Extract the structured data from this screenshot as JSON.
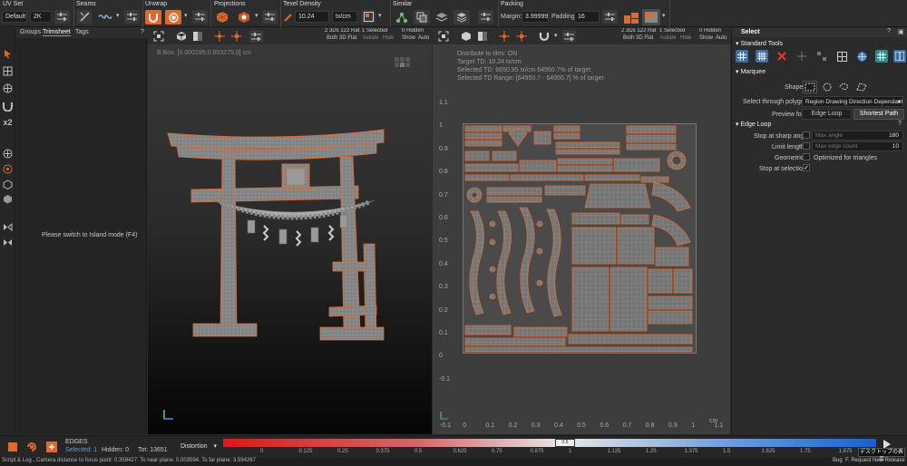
{
  "toolbar": {
    "sections": [
      "UV Set",
      "Seams",
      "Unwrap",
      "Projections",
      "Texel Density",
      "Similar",
      "Packing"
    ],
    "uvset_value": "Default",
    "uvset_num": "2K",
    "texel_value": "10.24",
    "texel_unit": "tx/cm",
    "margin_label": "Margin:",
    "margin_value": "3.99999",
    "padding_label": "Padding:",
    "padding_value": "16"
  },
  "left_panel": {
    "tabs": [
      "Groups",
      "Trimsheet",
      "Tags"
    ],
    "message": "Please switch to Island mode (F4)"
  },
  "viewport3d": {
    "bbox": "B Box: [0.000185,0.003275,0] cm",
    "stats_line1": "2 3Ds 122 Rat",
    "stats_line2": "Both 3D Flat",
    "selected_label": "1 Selected",
    "isolate_label": "Isolate",
    "hide_label": "Hide",
    "hidden_label": "0 Hidden",
    "show_label": "Show",
    "auto_label": "Auto"
  },
  "uv_view": {
    "info": [
      "Distribute to tiles: ON",
      "Target TD: 10.24 tx/cm",
      "Selected TD: 6650.95 tx/cm 64950.7% of target",
      "Selected TD Range: [64950.7 - 64950.7] % of target"
    ],
    "stats_line1": "2 3Ds 122 Rat",
    "stats_line2": "Both 3D Flat",
    "selected_label": "1 Selected",
    "isolate_label": "Isolate",
    "hide_label": "Hide",
    "hidden_label": "0 Hidden",
    "show_label": "Show",
    "auto_label": "Auto",
    "y_ticks": [
      "1.1",
      "1",
      "0.9",
      "0.8",
      "0.7",
      "0.6",
      "0.5",
      "0.4",
      "0.3",
      "0.2",
      "0.1",
      "0",
      "-0.1"
    ],
    "x_ticks": [
      "-0.1",
      "0",
      "0.1",
      "0.2",
      "0.3",
      "0.4",
      "0.5",
      "0.6",
      "0.7",
      "0.8",
      "0.9",
      "1",
      "1.1"
    ],
    "unit": "cm"
  },
  "right_panel": {
    "title": "Select",
    "standard_tools": "Standard Tools",
    "marquee": "Marquee",
    "shape_label": "Shape",
    "select_through_label": "Select through polygons",
    "select_through_value": "Region Drawing Direction Dependant",
    "preview_for": "Preview for",
    "edge_loop_btn": "Edge Loop",
    "shortest_path_btn": "Shortest Path",
    "edge_loop_section": "Edge Loop",
    "stop_angle_label": "Stop at sharp angle",
    "max_angle_label": "Max angle",
    "max_angle_value": "180",
    "limit_length_label": "Limit length",
    "max_edge_label": "Max edge count",
    "max_edge_value": "10",
    "geometric_label": "Geometric",
    "optimized_label": "Optimized for triangles",
    "stop_selection_label": "Stop at selection"
  },
  "bottom": {
    "mode": "EDGES",
    "selected": "Selected: 1",
    "hidden": "Hidden: 0",
    "tot": "Tot: 13651",
    "distortion": "Distortion",
    "ticks": [
      "0",
      "0.125",
      "0.25",
      "0.375",
      "0.5",
      "0.625",
      "0.75",
      "0.875",
      "1",
      "1.125",
      "1.25",
      "1.375",
      "1.5",
      "1.625",
      "1.75",
      "1.875"
    ],
    "marker": "0.5"
  },
  "status": {
    "left": "Script & Log...",
    "message": "Camera distance to focus point: 0.359427. To near plane: 0.003594. To far plane: 3.594267",
    "bug": "Bug",
    "request": "F. Request",
    "release": "New Release",
    "desktop": "デスクトップの表示"
  },
  "colors": {
    "accent": "#e06a2c",
    "panel": "#2b2b2b",
    "dark": "#1e1e1e",
    "uvbg": "#3d3d3d",
    "select_blue": "#5aa0d8"
  }
}
